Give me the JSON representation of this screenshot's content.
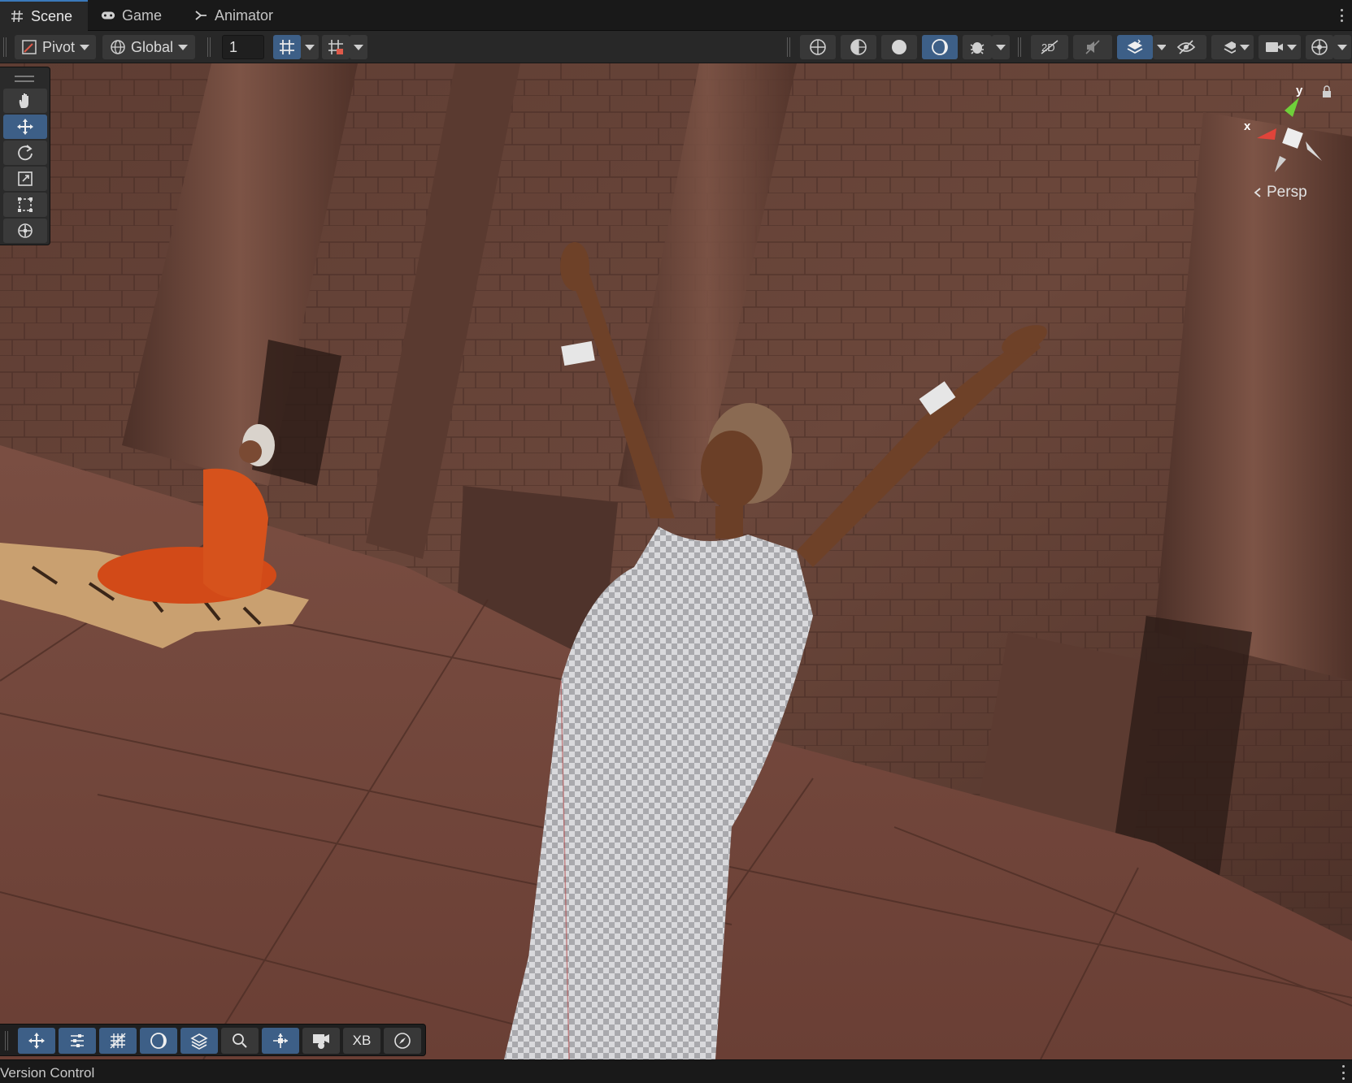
{
  "tabs": [
    {
      "label": "Scene",
      "icon": "hash-icon",
      "active": true
    },
    {
      "label": "Game",
      "icon": "gamepad-icon",
      "active": false
    },
    {
      "label": "Animator",
      "icon": "animator-icon",
      "active": false
    }
  ],
  "toolbar": {
    "pivot_label": "Pivot",
    "global_label": "Global",
    "grid_size_value": "1"
  },
  "tool_palette": {
    "tools": [
      "hand-tool",
      "move-tool",
      "rotate-tool",
      "scale-tool",
      "rect-tool",
      "transform-tool"
    ],
    "selected": "move-tool"
  },
  "scene_view": {
    "projection_label": "Persp",
    "axis_y_label": "y",
    "axis_x_label": "x"
  },
  "overlay_toolbar": {
    "xr_label": "XB"
  },
  "status_bar": {
    "label": "Version Control"
  },
  "colors": {
    "accent_selected": "#3d5f87",
    "tab_underline": "#3a79bb",
    "background_dark": "#191919",
    "toolbar": "#282828"
  }
}
